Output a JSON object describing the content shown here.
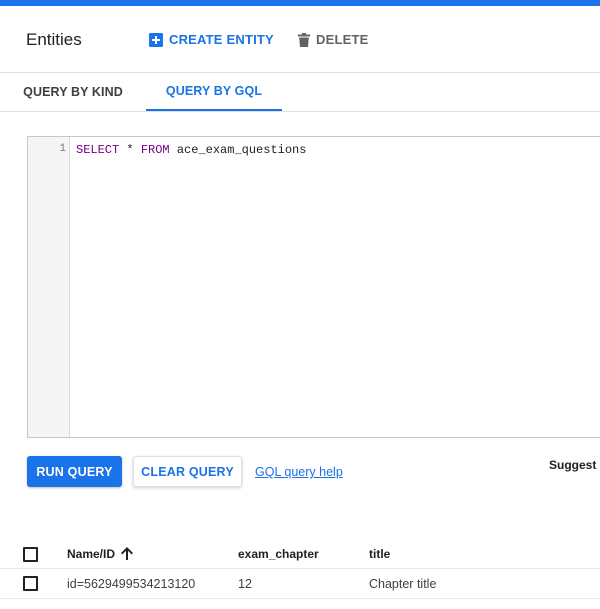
{
  "header": {
    "title": "Entities",
    "create_label": "CREATE ENTITY",
    "delete_label": "DELETE"
  },
  "tabs": [
    {
      "label": "QUERY BY KIND",
      "active": false
    },
    {
      "label": "QUERY BY GQL",
      "active": true
    }
  ],
  "editor": {
    "line_number": "1",
    "tokens": {
      "select": "SELECT",
      "star": " * ",
      "from": "FROM",
      "table": " ace_exam_questions"
    }
  },
  "actions": {
    "run_label": "RUN QUERY",
    "clear_label": "CLEAR QUERY",
    "help_label": "GQL query help",
    "suggest_label": "Suggest"
  },
  "table": {
    "columns": [
      "Name/ID",
      "exam_chapter",
      "title"
    ],
    "rows": [
      {
        "name_id": "id=5629499534213120",
        "exam_chapter": "12",
        "title": "Chapter title"
      }
    ]
  },
  "colors": {
    "accent": "#1a73e8",
    "keyword": "#770088"
  }
}
